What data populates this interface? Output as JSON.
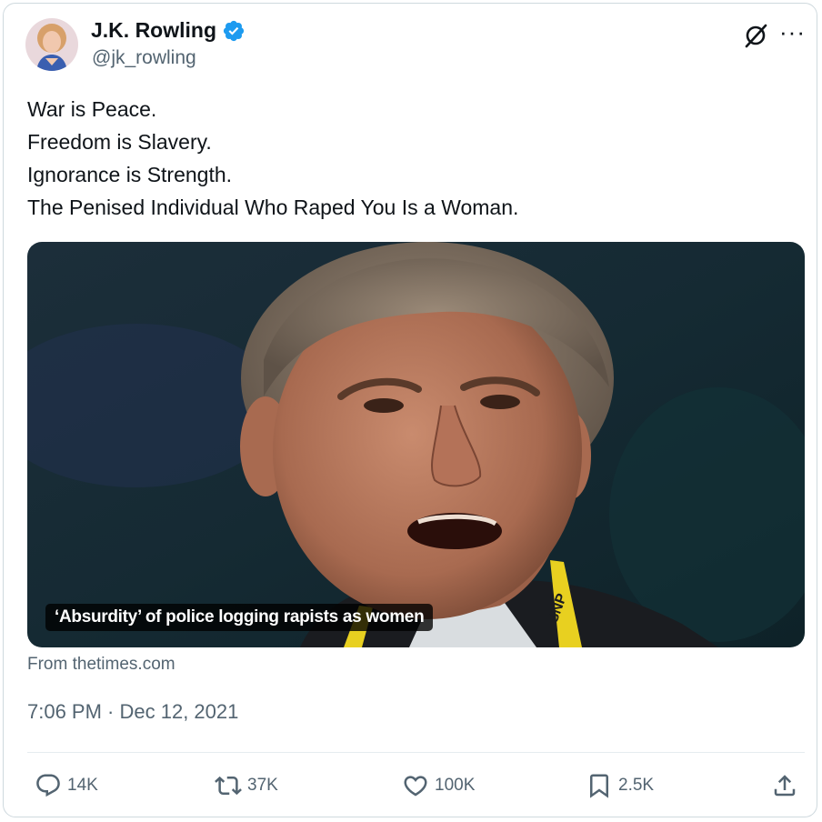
{
  "author": {
    "name": "J.K. Rowling",
    "handle": "@jk_rowling"
  },
  "tweet": {
    "lines": [
      "War is Peace.",
      "Freedom is Slavery.",
      "Ignorance is Strength.",
      "The Penised Individual Who Raped You Is a Woman."
    ]
  },
  "media": {
    "caption": "‘Absurdity’ of police logging rapists as women",
    "lanyard_text": "SNP"
  },
  "source": "From thetimes.com",
  "timestamp": "7:06 PM · Dec 12, 2021",
  "actions": {
    "replies": "14K",
    "reposts": "37K",
    "likes": "100K",
    "bookmarks": "2.5K"
  },
  "colors": {
    "text_primary": "#0f1419",
    "text_secondary": "#536471",
    "verified": "#1d9bf0",
    "border": "#cfd9de"
  },
  "icons": [
    "verified-badge-icon",
    "grok-icon",
    "more-icon",
    "reply-icon",
    "repost-icon",
    "like-icon",
    "bookmark-icon",
    "share-icon"
  ]
}
